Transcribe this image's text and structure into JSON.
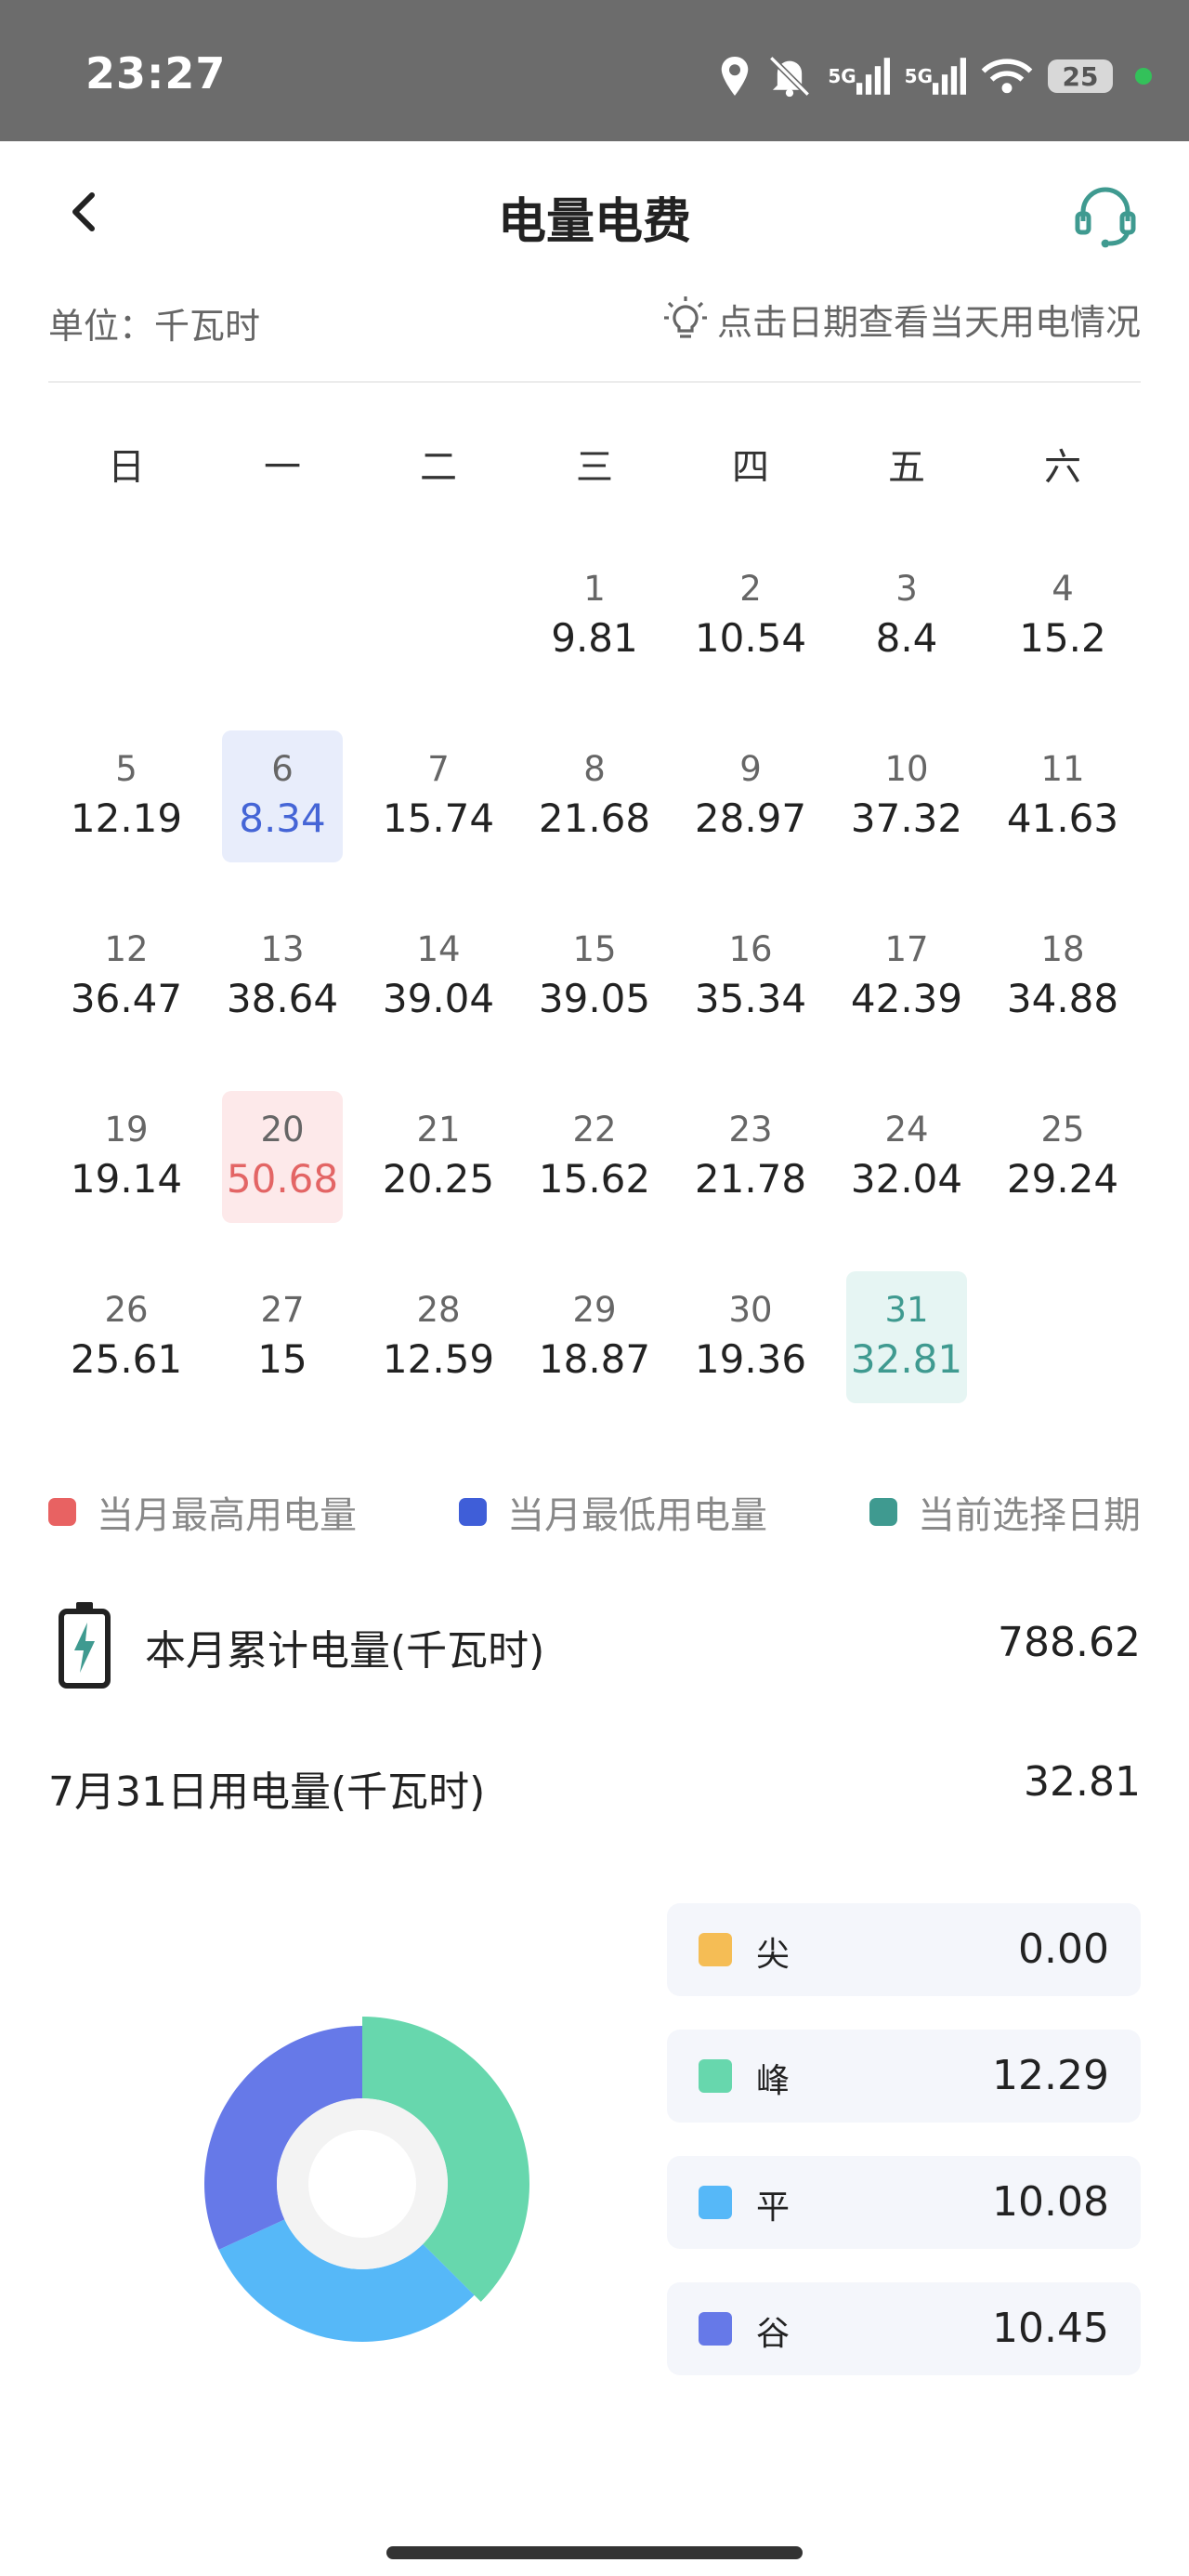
{
  "status": {
    "time": "23:27",
    "net1": "5G",
    "net2": "5G",
    "battery": "25"
  },
  "header": {
    "title": "电量电费"
  },
  "unit_label": "单位：千瓦时",
  "hint": "点击日期查看当天用电情况",
  "weekdays": [
    "日",
    "一",
    "二",
    "三",
    "四",
    "五",
    "六"
  ],
  "calendar": [
    [
      null,
      null,
      null,
      {
        "day": "1",
        "value": "9.81"
      },
      {
        "day": "2",
        "value": "10.54"
      },
      {
        "day": "3",
        "value": "8.4"
      },
      {
        "day": "4",
        "value": "15.2"
      }
    ],
    [
      {
        "day": "5",
        "value": "12.19"
      },
      {
        "day": "6",
        "value": "8.34",
        "mark": "low"
      },
      {
        "day": "7",
        "value": "15.74"
      },
      {
        "day": "8",
        "value": "21.68"
      },
      {
        "day": "9",
        "value": "28.97"
      },
      {
        "day": "10",
        "value": "37.32"
      },
      {
        "day": "11",
        "value": "41.63"
      }
    ],
    [
      {
        "day": "12",
        "value": "36.47"
      },
      {
        "day": "13",
        "value": "38.64"
      },
      {
        "day": "14",
        "value": "39.04"
      },
      {
        "day": "15",
        "value": "39.05"
      },
      {
        "day": "16",
        "value": "35.34"
      },
      {
        "day": "17",
        "value": "42.39"
      },
      {
        "day": "18",
        "value": "34.88"
      }
    ],
    [
      {
        "day": "19",
        "value": "19.14"
      },
      {
        "day": "20",
        "value": "50.68",
        "mark": "high"
      },
      {
        "day": "21",
        "value": "20.25"
      },
      {
        "day": "22",
        "value": "15.62"
      },
      {
        "day": "23",
        "value": "21.78"
      },
      {
        "day": "24",
        "value": "32.04"
      },
      {
        "day": "25",
        "value": "29.24"
      }
    ],
    [
      {
        "day": "26",
        "value": "25.61"
      },
      {
        "day": "27",
        "value": "15"
      },
      {
        "day": "28",
        "value": "12.59"
      },
      {
        "day": "29",
        "value": "18.87"
      },
      {
        "day": "30",
        "value": "19.36"
      },
      {
        "day": "31",
        "value": "32.81",
        "mark": "selected"
      },
      null
    ]
  ],
  "legend": [
    {
      "label": "当月最高用电量",
      "color": "#e86262"
    },
    {
      "label": "当月最低用电量",
      "color": "#3f5ed8"
    },
    {
      "label": "当前选择日期",
      "color": "#3f9a90"
    }
  ],
  "summary": {
    "month_total_label": "本月累计电量(千瓦时)",
    "month_total_value": "788.62",
    "day_label": "7月31日用电量(千瓦时)",
    "day_value": "32.81"
  },
  "breakdown": [
    {
      "label": "尖",
      "value": "0.00",
      "num": 0.0,
      "color": "#f5bd55"
    },
    {
      "label": "峰",
      "value": "12.29",
      "num": 12.29,
      "color": "#67d7ad"
    },
    {
      "label": "平",
      "value": "10.08",
      "num": 10.08,
      "color": "#56b8f8"
    },
    {
      "label": "谷",
      "value": "10.45",
      "num": 10.45,
      "color": "#6679e8"
    }
  ]
}
